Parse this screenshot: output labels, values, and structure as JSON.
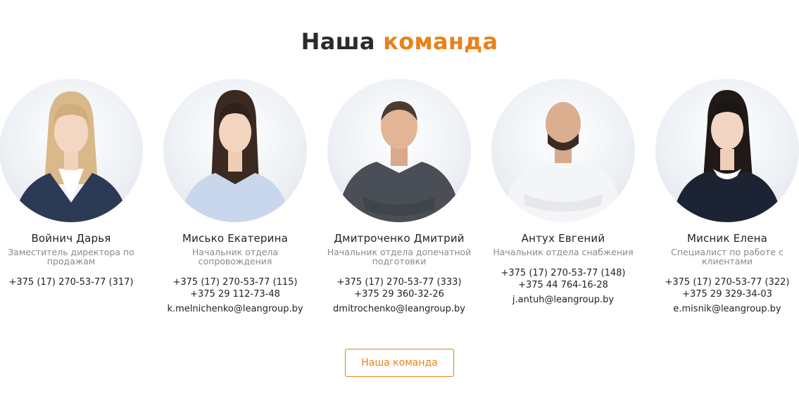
{
  "heading": {
    "part1": "Наша",
    "part2": "команда"
  },
  "accent_color": "#e8821a",
  "team": [
    {
      "name": "Войнич Дарья",
      "role": "Заместитель директора по продажам",
      "phone1": "+375 (17) 270-53-77 (317)",
      "phone2": "",
      "email": "",
      "photo": "woman-blonde-dark-suit"
    },
    {
      "name": "Мисько Екатерина",
      "role": "Начальник отдела сопровождения",
      "phone1": "+375 (17) 270-53-77 (115)",
      "phone2": "+375 29 112-73-48",
      "email": "k.melnichenko@leangroup.by",
      "photo": "woman-brunette-light-blue-shirt"
    },
    {
      "name": "Дмитроченко Дмитрий",
      "role": "Начальник отдела допечатной подготовки",
      "phone1": "+375 (17) 270-53-77 (333)",
      "phone2": "+375 29 360-32-26",
      "email": "dmitrochenko@leangroup.by",
      "photo": "man-gray-shirt"
    },
    {
      "name": "Антух Евгений",
      "role": "Начальник отдела снабжения",
      "phone1": "+375 (17) 270-53-77 (148)",
      "phone2": "+375 44 764-16-28",
      "email": "j.antuh@leangroup.by",
      "photo": "man-white-shirt"
    },
    {
      "name": "Мисник Елена",
      "role": "Специалист по работе с клиентами",
      "phone1": "+375 (17) 270-53-77 (322)",
      "phone2": "+375 29 329-34-03",
      "email": "e.misnik@leangroup.by",
      "photo": "woman-dark-hair-navy-dress"
    }
  ],
  "button": {
    "label": "Наша команда"
  }
}
